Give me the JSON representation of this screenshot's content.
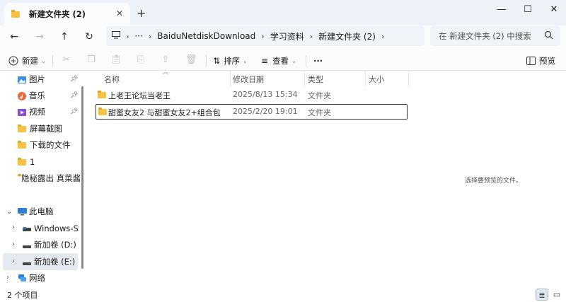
{
  "window": {
    "tab_title": "新建文件夹 (2)",
    "new_tab": "+",
    "minimize": "—",
    "maximize": "☐",
    "close": "✕"
  },
  "nav": {
    "back": "←",
    "forward": "→",
    "up": "↑",
    "refresh": "↻",
    "more": "···",
    "breadcrumb": [
      "BaiduNetdiskDownload",
      "学习资料",
      "新建文件夹 (2)"
    ],
    "search_placeholder": "在 新建文件夹 (2) 中搜索"
  },
  "toolbar": {
    "new_label": "新建",
    "sort_label": "排序",
    "view_label": "查看",
    "more_label": "···",
    "preview_label": "预览"
  },
  "sidebar": {
    "quick_access": [
      {
        "label": "图片",
        "icon": "pictures-icon",
        "pinned": true
      },
      {
        "label": "音乐",
        "icon": "music-icon",
        "pinned": true
      },
      {
        "label": "视频",
        "icon": "videos-icon",
        "pinned": true
      },
      {
        "label": "屏幕截图",
        "icon": "folder-icon",
        "pinned": false
      },
      {
        "label": "下载的文件",
        "icon": "folder-icon",
        "pinned": false
      },
      {
        "label": "1",
        "icon": "folder-icon",
        "pinned": false
      },
      {
        "label": "隐秘露出 真菜酱",
        "icon": "folder-icon",
        "pinned": false
      }
    ],
    "this_pc": "此电脑",
    "drives": [
      {
        "label": "Windows-SSD"
      },
      {
        "label": "新加卷 (D:)"
      },
      {
        "label": "新加卷 (E:)",
        "selected": true
      }
    ],
    "network": "网络"
  },
  "columns": {
    "name": "名称",
    "modified": "修改日期",
    "type": "类型",
    "size": "大小"
  },
  "files": [
    {
      "name": "上老王论坛当老王",
      "modified": "2025/8/13 15:34",
      "type": "文件夹",
      "size": ""
    },
    {
      "name": "甜蜜女友2 与甜蜜女友2+组合包",
      "modified": "2025/2/20 19:01",
      "type": "文件夹",
      "size": "",
      "focused": true
    }
  ],
  "preview": {
    "empty_text": "选择要预览的文件。"
  },
  "status": {
    "item_count": "2 个项目"
  },
  "colors": {
    "folder": "#f5c342",
    "titlebar_bg": "#eef3f9",
    "accent": "#0067c0"
  }
}
